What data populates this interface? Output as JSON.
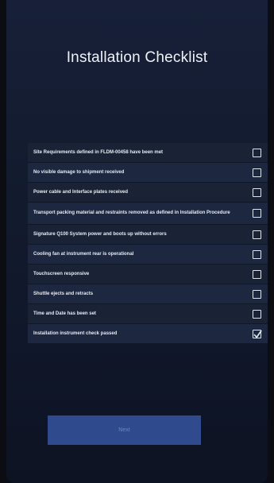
{
  "page": {
    "title": "Installation Checklist"
  },
  "checklist": {
    "items": [
      {
        "label": "Site Requirements defined in FLDM-00458 have been met",
        "checked": false
      },
      {
        "label": "No visible damage to shipment received",
        "checked": false
      },
      {
        "label": "Power cable and Interface plates received",
        "checked": false
      },
      {
        "label": "Transport packing material and restraints removed as defined in Installation Procedure",
        "checked": false
      },
      {
        "label": "Signature Q100 System power and boots up without errors",
        "checked": false
      },
      {
        "label": "Cooling fan at instrument rear is operational",
        "checked": false
      },
      {
        "label": "Touchscreen responsive",
        "checked": false
      },
      {
        "label": "Shuttle ejects and retracts",
        "checked": false
      },
      {
        "label": "Time and Date has been set",
        "checked": false
      },
      {
        "label": "Installation instrument check passed",
        "checked": true
      }
    ]
  },
  "footer": {
    "next_label": "Next"
  },
  "colors": {
    "background_top": "#172038",
    "background_bottom": "#0d1322",
    "row_background": "#1a2336",
    "button_background": "#2f4b8d",
    "button_text": "#6f86bf",
    "text": "#e6ebf3"
  }
}
